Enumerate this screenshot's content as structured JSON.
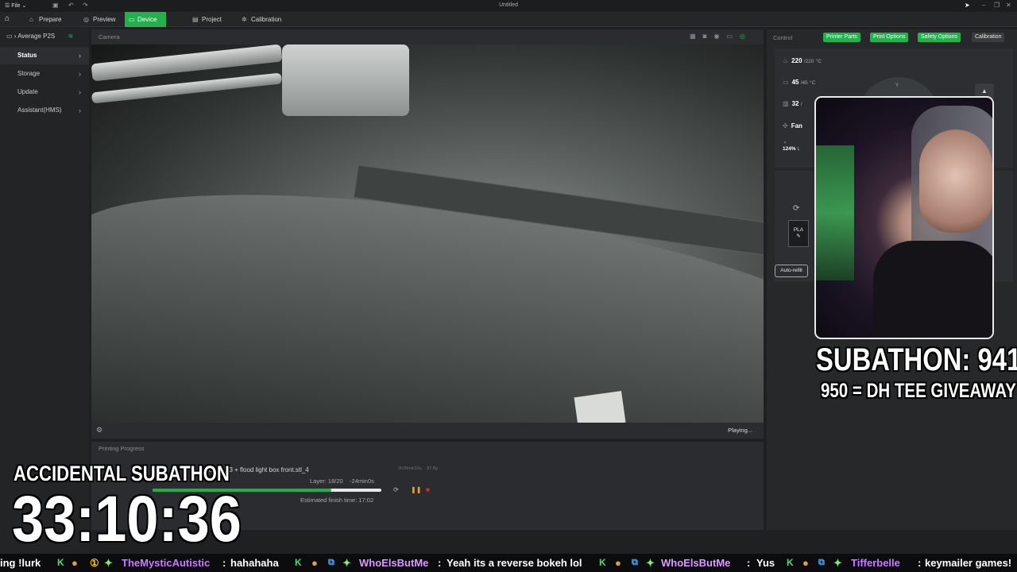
{
  "app": {
    "file_menu": "File",
    "window_title": "Untitled"
  },
  "tabs": [
    {
      "label": "Prepare"
    },
    {
      "label": "Preview"
    },
    {
      "label": "Device"
    },
    {
      "label": "Project"
    },
    {
      "label": "Calibration"
    }
  ],
  "sidebar": {
    "printer_name": "Average P2S",
    "items": [
      {
        "label": "Status"
      },
      {
        "label": "Storage"
      },
      {
        "label": "Update"
      },
      {
        "label": "Assistant(HMS)"
      }
    ]
  },
  "camera": {
    "header": "Camera",
    "status": "Playing..."
  },
  "printing_progress": {
    "header": "Printing Progress",
    "file_name": "ront.stl_3 + flood light box front.stl_4",
    "meta_time": "2h28min16s",
    "meta_weight": "87.8g",
    "layer": "Layer: 18/20",
    "remaining": "-24min0s",
    "progress_fraction": 0.78,
    "finish_time": "Estimated finish time: 17:02"
  },
  "control": {
    "header": "Control",
    "buttons": [
      "Printer Parts",
      "Print Options",
      "Safety Options",
      "Calibration"
    ],
    "nozzle_temp": "220",
    "nozzle_target": "/220",
    "nozzle_unit": "°C",
    "bed_temp": "45",
    "bed_target": "/45",
    "bed_unit": "°C",
    "chamber_temp": "32",
    "chamber_target": "/",
    "fan_label": "Fan",
    "speed": "124%",
    "speed_label": "L",
    "filament": "PLA",
    "auto_refill": "Auto-refill",
    "jog_label": "Y"
  },
  "stream_overlay": {
    "subathon_count": "SUBATHON: 941",
    "giveaway": "950 = DH TEE GIVEAWAY",
    "accidental_title": "ACCIDENTAL SUBATHON",
    "timer": "33:10:36"
  },
  "ticker": {
    "lead": "ing !lurk",
    "messages": [
      {
        "user": "TheMysticAutistic",
        "text": "hahahaha"
      },
      {
        "user": "WhoElsButMe",
        "text": "Yeah its a reverse bokeh lol"
      },
      {
        "user": "WhoElsButMe",
        "text": "Yus"
      },
      {
        "user": "Tifferbelle",
        "text": "keymailer games!"
      }
    ]
  }
}
